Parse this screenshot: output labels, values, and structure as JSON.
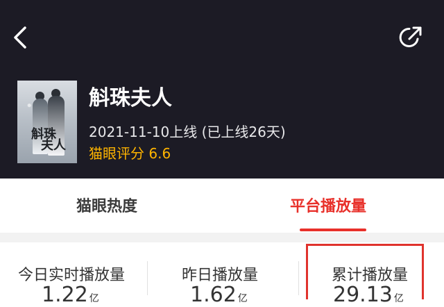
{
  "header": {
    "title": "斛珠夫人",
    "release_info": "2021-11-10上线 (已上线26天)",
    "rating_label": "猫眼评分 6.6",
    "poster_logo_line1": "斛珠",
    "poster_logo_line2": "夫人"
  },
  "tabs": [
    {
      "label": "猫眼热度",
      "active": false
    },
    {
      "label": "平台播放量",
      "active": true
    }
  ],
  "stats": [
    {
      "label": "今日实时播放量",
      "value": "1.22",
      "unit": "亿"
    },
    {
      "label": "昨日播放量",
      "value": "1.62",
      "unit": "亿"
    },
    {
      "label": "累计播放量",
      "value": "29.13",
      "unit": "亿"
    }
  ],
  "colors": {
    "header_bg": "#1c1b25",
    "accent_red": "#e8302a",
    "rating_gold": "#ffb400"
  },
  "icons": {
    "back": "chevron-left-icon",
    "share": "share-icon"
  }
}
